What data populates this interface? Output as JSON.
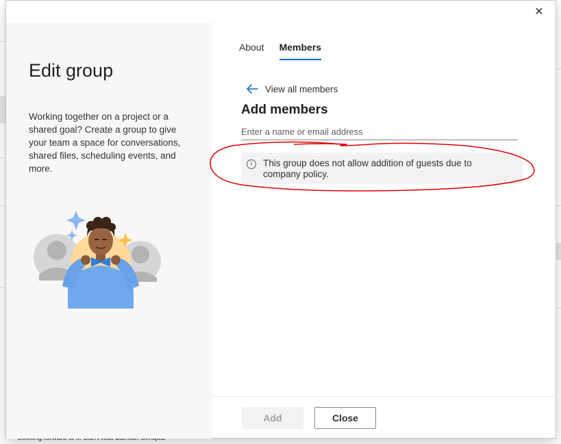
{
  "background": {
    "footer_snippet": "Looking forward to it.  Can't wait  Damian Senquiz"
  },
  "dialog": {
    "close_glyph": "✕",
    "left": {
      "title": "Edit group",
      "description": "Working together on a project or a shared goal? Create a group to give your team a space for conversations, shared files, scheduling events, and more."
    },
    "tabs": [
      {
        "label": "About",
        "active": false
      },
      {
        "label": "Members",
        "active": true
      }
    ],
    "members": {
      "back_link": "View all members",
      "section_title": "Add members",
      "input_placeholder": "Enter a name or email address",
      "input_value": "",
      "info_message": "This group does not allow addition of guests due to company policy."
    },
    "footer": {
      "add_label": "Add",
      "close_label": "Close"
    }
  },
  "colors": {
    "accent": "#0f6cbd",
    "annotation": "#e00000",
    "left_pane_bg": "#f8f7f6"
  }
}
